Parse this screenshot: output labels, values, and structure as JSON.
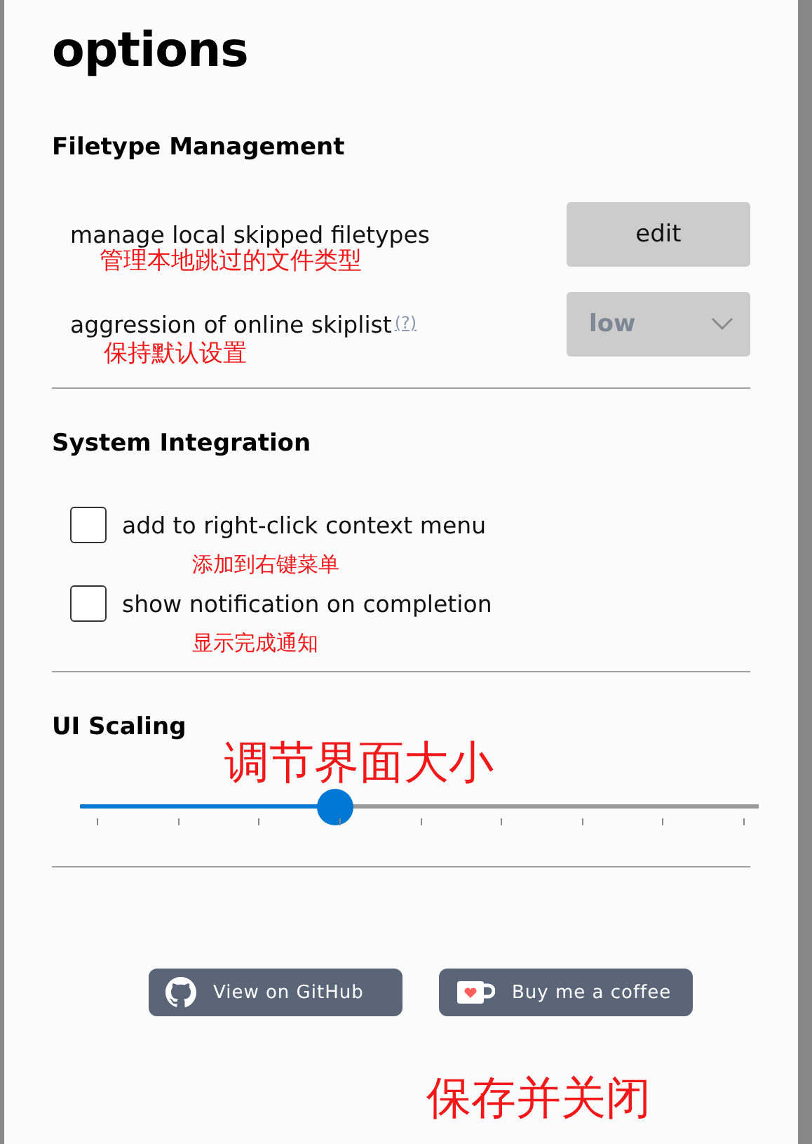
{
  "title": "options",
  "sections": [
    {
      "heading": "Filetype Management",
      "rows": [
        {
          "kind": "button",
          "label": "manage local skipped filetypes",
          "note": "管理本地跳过的文件类型",
          "button": "edit"
        },
        {
          "kind": "select",
          "label": "aggression of online skiplist",
          "help": "(?)",
          "note": "保持默认设置",
          "value": "low",
          "disabled": true
        }
      ]
    },
    {
      "heading": "System Integration",
      "rows": [
        {
          "kind": "checkbox",
          "label": "add to right-click context menu",
          "note": "添加到右键菜单",
          "checked": false
        },
        {
          "kind": "checkbox",
          "label": "show notification on completion",
          "note": "显示完成通知",
          "checked": false
        }
      ]
    },
    {
      "heading": "UI Scaling",
      "rows": [
        {
          "kind": "slider",
          "note": "调节界面大小",
          "level": 0.375
        }
      ]
    }
  ],
  "links": [
    {
      "kind": "github",
      "label": "View on GitHub"
    },
    {
      "kind": "coffee",
      "label": "Buy me a coffee"
    }
  ],
  "footer_note": "保存并关闭"
}
